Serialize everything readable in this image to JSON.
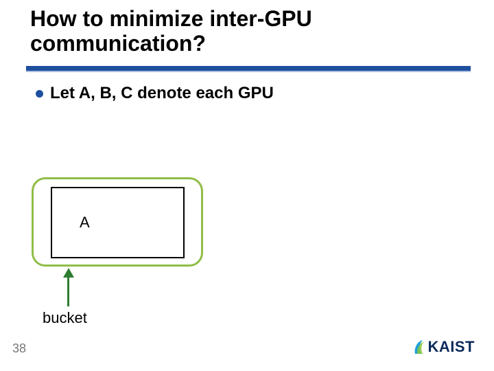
{
  "title": "How to minimize inter-GPU communication?",
  "bullet1": "Let A, B, C denote each GPU",
  "diagram": {
    "inner_label": "A",
    "bucket_label": "bucket"
  },
  "page_number": "38",
  "logo": {
    "text": "KAIST"
  },
  "colors": {
    "accent_blue": "#1f4f9e",
    "bucket_green": "#8fbd46",
    "arrow_green": "#2e7d32"
  }
}
